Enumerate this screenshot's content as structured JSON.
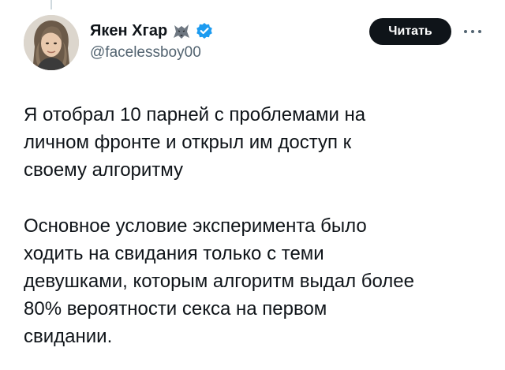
{
  "author": {
    "display_name": "Якен Хгар",
    "handle": "@facelessboy00",
    "name_emoji_icon": "wolf-icon",
    "verified_icon": "verified-badge-icon",
    "verified_color": "#1d9bf0"
  },
  "actions": {
    "follow_label": "Читать",
    "more_icon": "more-horizontal-icon"
  },
  "tweet": {
    "paragraphs": [
      {
        "lines": [
          "Я отобрал 10 парней с проблемами на",
          "личном фронте и открыл им доступ к",
          "своему алгоритму"
        ]
      },
      {
        "lines": [
          "Основное условие эксперимента было",
          "ходить на свидания только с теми",
          "девушками, которым алгоритм выдал более",
          "80% вероятности секса на первом",
          "свидании."
        ]
      }
    ]
  },
  "colors": {
    "text_primary": "#0f1419",
    "text_secondary": "#536471",
    "button_bg": "#0f1419",
    "button_text": "#ffffff"
  }
}
